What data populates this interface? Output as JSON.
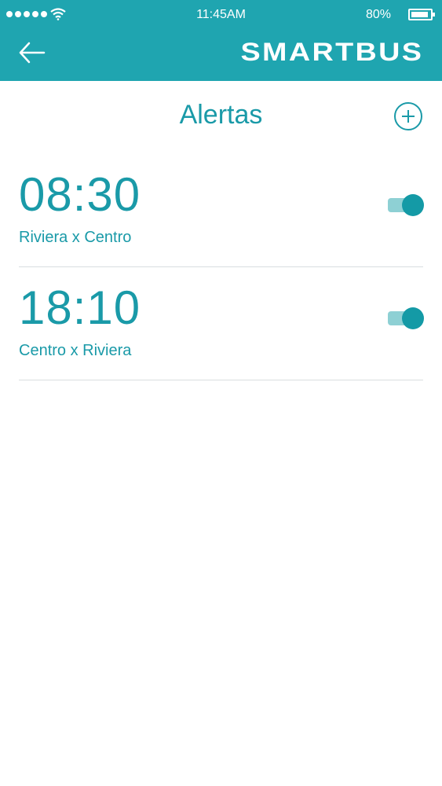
{
  "status_bar": {
    "time": "11:45AM",
    "battery_percent": "80%",
    "battery_level": 0.8,
    "signal_bars": 5,
    "wifi_icon": "wifi-icon"
  },
  "header": {
    "brand": "SMARTBUS",
    "back_icon": "arrow-left-icon",
    "background_color": "#1fa5b0"
  },
  "page": {
    "title": "Alertas",
    "add_icon": "plus-circle-icon",
    "accent_color": "#1a9aa8"
  },
  "alerts": [
    {
      "time": "08:30",
      "route": "Riviera x Centro",
      "enabled": true
    },
    {
      "time": "18:10",
      "route": "Centro x Riviera",
      "enabled": true
    }
  ]
}
